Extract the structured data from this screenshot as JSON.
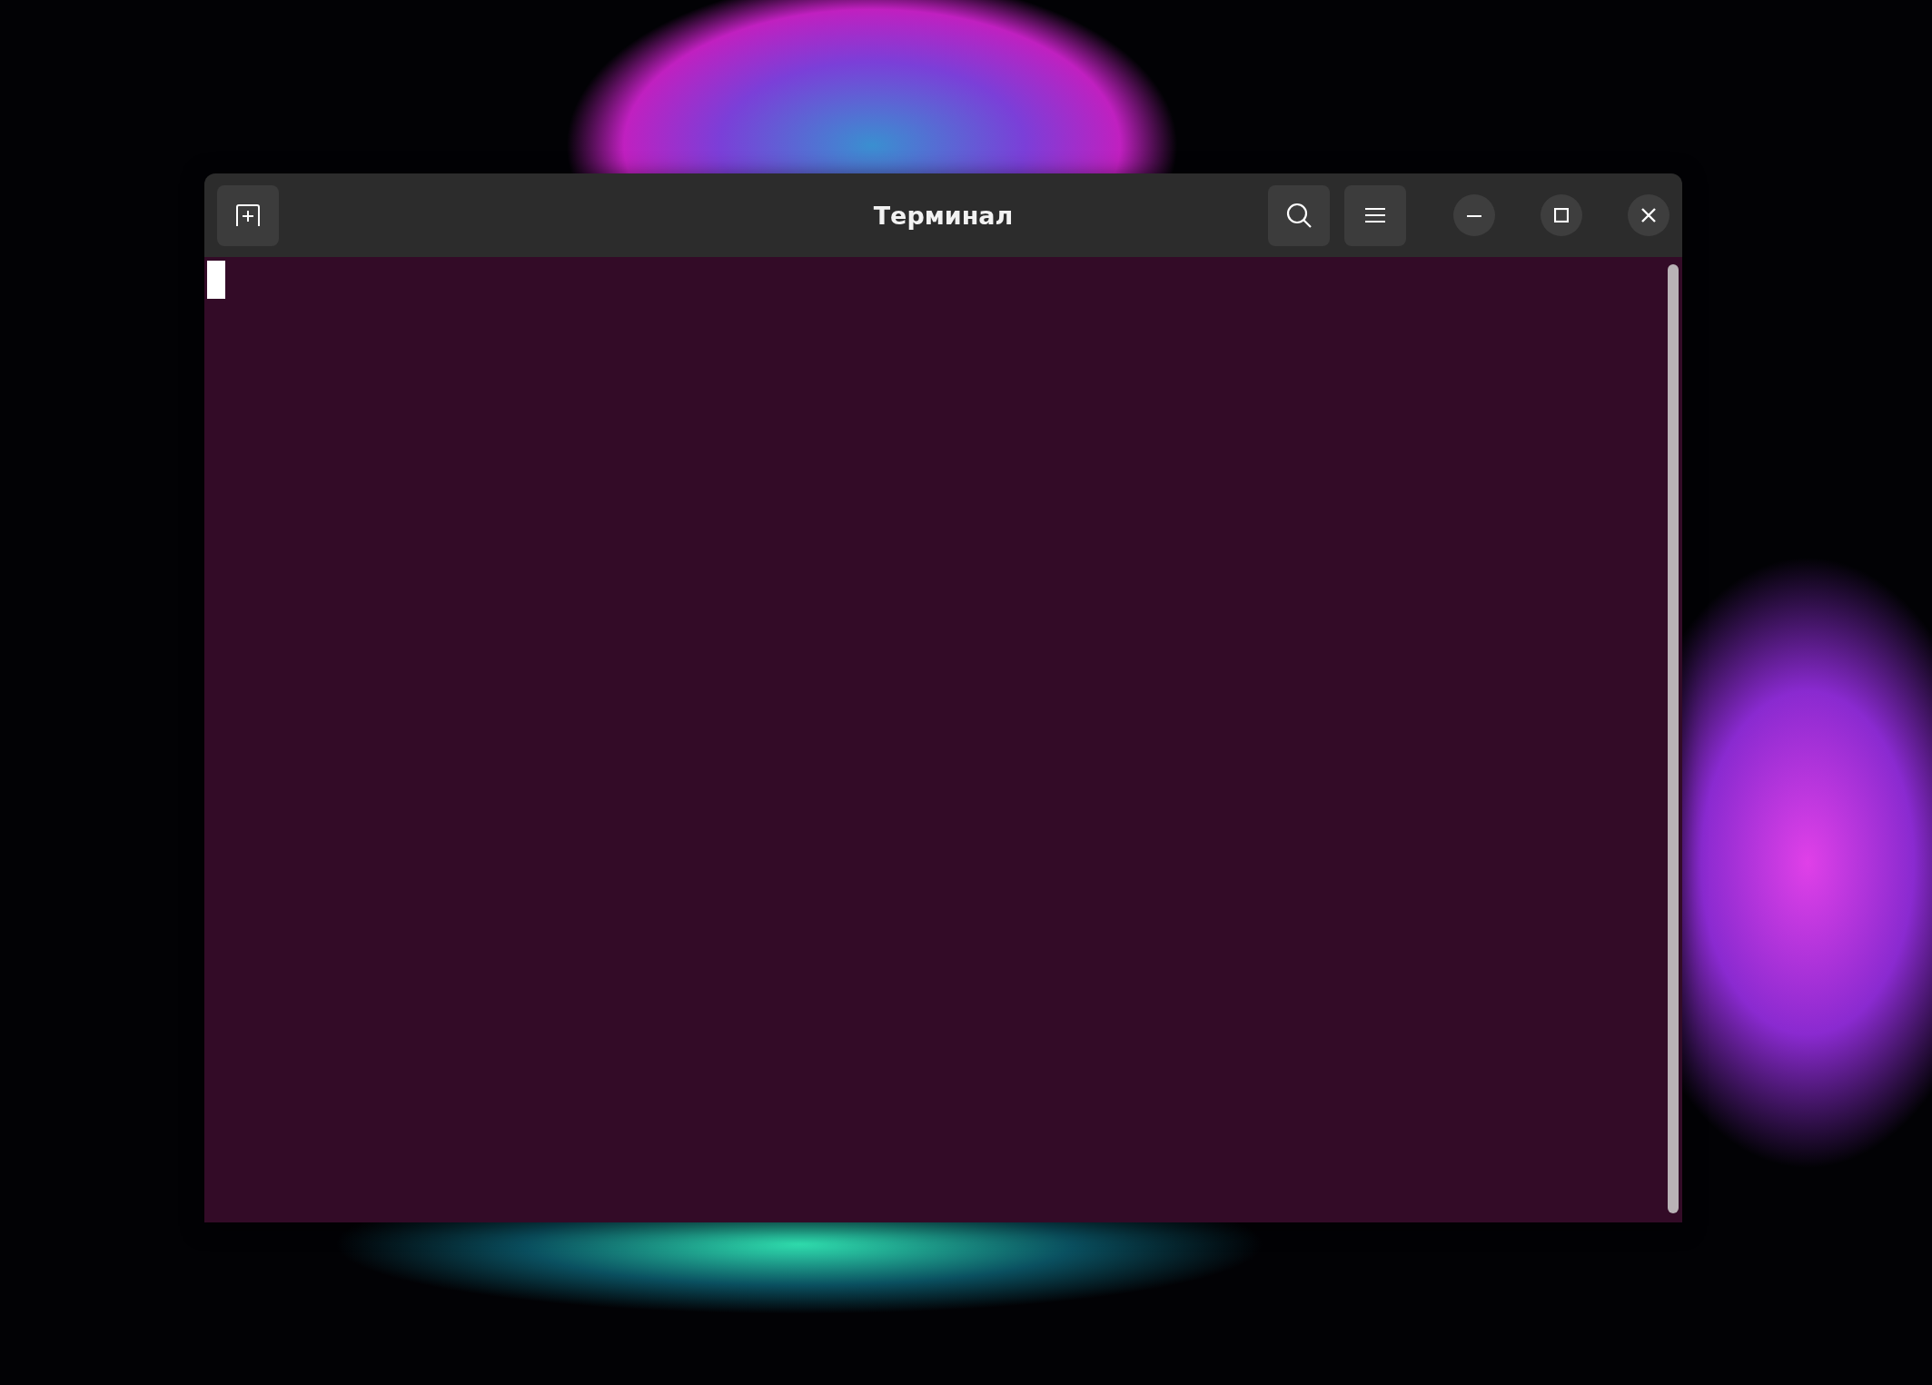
{
  "window": {
    "title": "Терминал"
  }
}
